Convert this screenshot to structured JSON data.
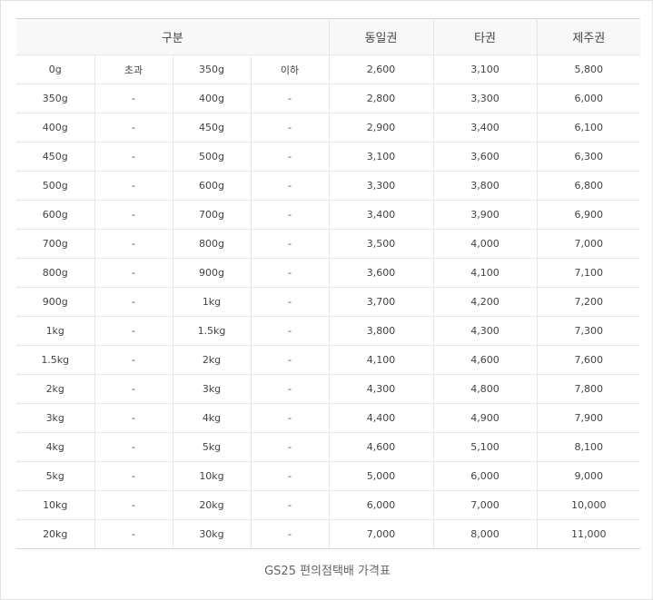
{
  "table": {
    "headers": [
      "구분",
      "동일권",
      "타권",
      "제주권"
    ],
    "rows": [
      [
        "0g",
        "초과",
        "350g",
        "이하",
        "2,600",
        "3,100",
        "5,800"
      ],
      [
        "350g",
        "-",
        "400g",
        "-",
        "2,800",
        "3,300",
        "6,000"
      ],
      [
        "400g",
        "-",
        "450g",
        "-",
        "2,900",
        "3,400",
        "6,100"
      ],
      [
        "450g",
        "-",
        "500g",
        "-",
        "3,100",
        "3,600",
        "6,300"
      ],
      [
        "500g",
        "-",
        "600g",
        "-",
        "3,300",
        "3,800",
        "6,800"
      ],
      [
        "600g",
        "-",
        "700g",
        "-",
        "3,400",
        "3,900",
        "6,900"
      ],
      [
        "700g",
        "-",
        "800g",
        "-",
        "3,500",
        "4,000",
        "7,000"
      ],
      [
        "800g",
        "-",
        "900g",
        "-",
        "3,600",
        "4,100",
        "7,100"
      ],
      [
        "900g",
        "-",
        "1kg",
        "-",
        "3,700",
        "4,200",
        "7,200"
      ],
      [
        "1kg",
        "-",
        "1.5kg",
        "-",
        "3,800",
        "4,300",
        "7,300"
      ],
      [
        "1.5kg",
        "-",
        "2kg",
        "-",
        "4,100",
        "4,600",
        "7,600"
      ],
      [
        "2kg",
        "-",
        "3kg",
        "-",
        "4,300",
        "4,800",
        "7,800"
      ],
      [
        "3kg",
        "-",
        "4kg",
        "-",
        "4,400",
        "4,900",
        "7,900"
      ],
      [
        "4kg",
        "-",
        "5kg",
        "-",
        "4,600",
        "5,100",
        "8,100"
      ],
      [
        "5kg",
        "-",
        "10kg",
        "-",
        "5,000",
        "6,000",
        "9,000"
      ],
      [
        "10kg",
        "-",
        "20kg",
        "-",
        "6,000",
        "7,000",
        "10,000"
      ],
      [
        "20kg",
        "-",
        "30kg",
        "-",
        "7,000",
        "8,000",
        "11,000"
      ]
    ]
  },
  "caption": "GS25 편의점택배 가격표"
}
